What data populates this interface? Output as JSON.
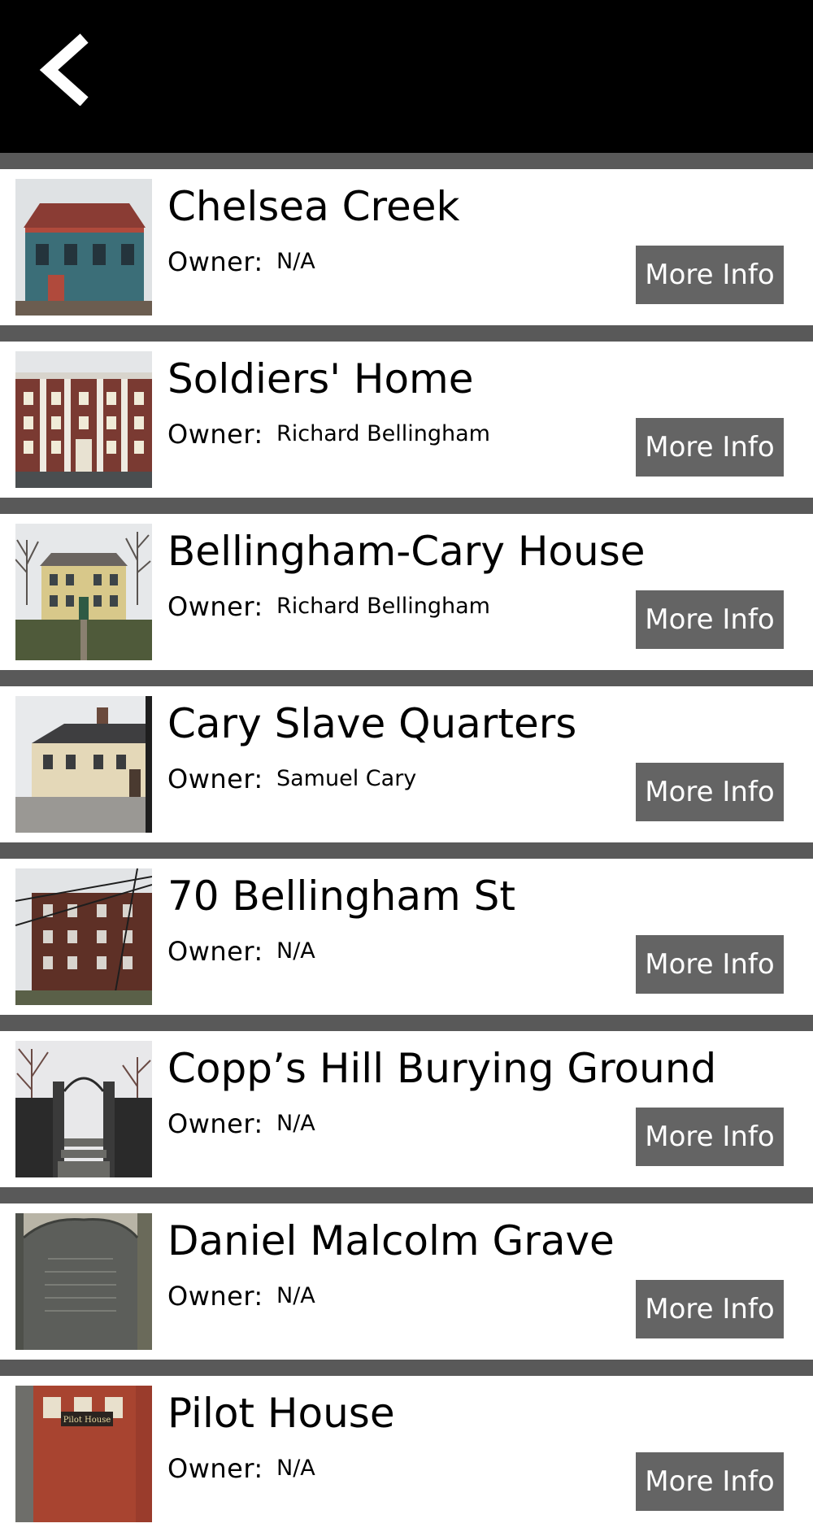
{
  "header": {
    "back_icon": "chevron-left-icon",
    "background_color": "#000000"
  },
  "list": {
    "separator_color": "#595959",
    "button_color": "#646464",
    "items": [
      {
        "title": "Chelsea Creek",
        "owner_label": "Owner:",
        "owner": "N/A",
        "button_label": "More Info"
      },
      {
        "title": "Soldiers' Home",
        "owner_label": "Owner:",
        "owner": "Richard Bellingham",
        "button_label": "More Info"
      },
      {
        "title": "Bellingham-Cary House",
        "owner_label": "Owner:",
        "owner": "Richard Bellingham",
        "button_label": "More Info"
      },
      {
        "title": "Cary Slave Quarters",
        "owner_label": "Owner:",
        "owner": "Samuel Cary",
        "button_label": "More Info"
      },
      {
        "title": "70 Bellingham St",
        "owner_label": "Owner:",
        "owner": "N/A",
        "button_label": "More Info"
      },
      {
        "title": "Copp’s Hill Burying Ground",
        "owner_label": "Owner:",
        "owner": "N/A",
        "button_label": "More Info"
      },
      {
        "title": "Daniel Malcolm Grave",
        "owner_label": "Owner:",
        "owner": "N/A",
        "button_label": "More Info"
      },
      {
        "title": "Pilot House",
        "owner_label": "Owner:",
        "owner": "N/A",
        "button_label": "More Info",
        "thumb_sign": "Pilot House"
      }
    ]
  }
}
